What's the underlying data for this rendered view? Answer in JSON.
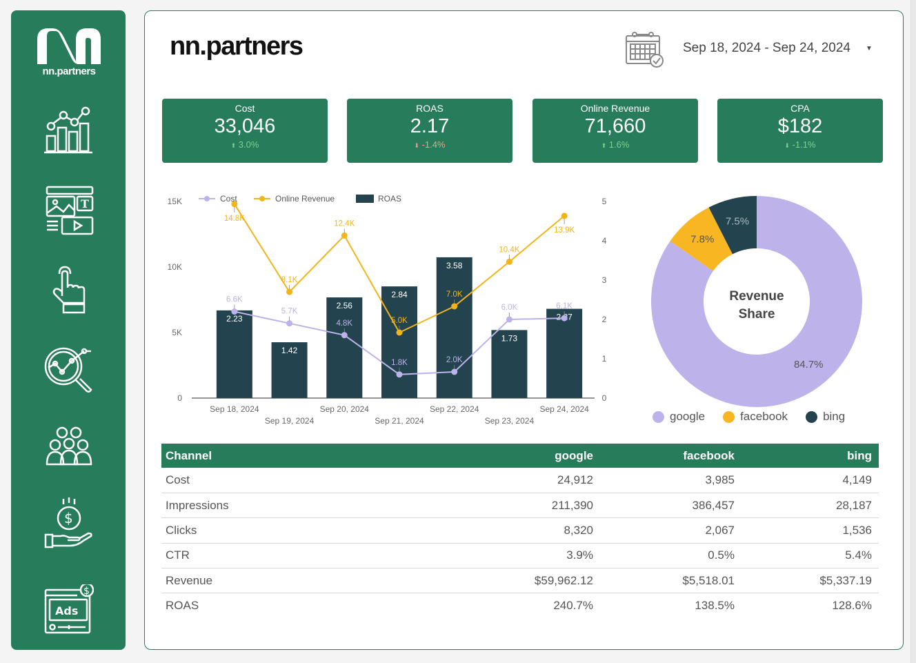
{
  "brand": {
    "name": "nn.partners",
    "sidebar_logo_text": "nn.partners"
  },
  "sidebar": {
    "items": [
      {
        "name": "analytics",
        "icon": "bar-line-chart-icon"
      },
      {
        "name": "content",
        "icon": "media-layout-icon"
      },
      {
        "name": "engagement",
        "icon": "pointing-hand-icon"
      },
      {
        "name": "insights",
        "icon": "magnifier-chart-icon"
      },
      {
        "name": "audience",
        "icon": "people-group-icon"
      },
      {
        "name": "revenue",
        "icon": "hand-coin-icon"
      },
      {
        "name": "ads",
        "icon": "ads-window-icon"
      }
    ]
  },
  "header": {
    "title": "nn.partners",
    "date_range": "Sep 18, 2024 - Sep 24, 2024",
    "date_icon": "calendar-check-icon",
    "dropdown_icon": "▾"
  },
  "kpis": [
    {
      "label": "Cost",
      "value": "33,046",
      "delta": "3.0%",
      "direction": "up",
      "arrow": "⬆"
    },
    {
      "label": "ROAS",
      "value": "2.17",
      "delta": "-1.4%",
      "direction": "down",
      "arrow": "⬇"
    },
    {
      "label": "Online Revenue",
      "value": "71,660",
      "delta": "1.6%",
      "direction": "up",
      "arrow": "⬆"
    },
    {
      "label": "CPA",
      "value": "$182",
      "delta": "-1.1%",
      "direction": "down",
      "arrow": "⬇"
    }
  ],
  "colors": {
    "brand_green": "#277c5b",
    "cost": "#bdb2ea",
    "revenue": "#f2b418",
    "roas_bar": "#23444f",
    "google": "#bdb2ea",
    "facebook": "#f8b722",
    "bing": "#23444f"
  },
  "chart_data": [
    {
      "type": "bar+line",
      "title": "",
      "categories": [
        "Sep 18, 2024",
        "Sep 19, 2024",
        "Sep 20, 2024",
        "Sep 21, 2024",
        "Sep 22, 2024",
        "Sep 23, 2024",
        "Sep 24, 2024"
      ],
      "legend": [
        "Cost",
        "Online Revenue",
        "ROAS"
      ],
      "legend_position": "top-left",
      "y_left": {
        "ticks": [
          "0",
          "5K",
          "10K",
          "15K"
        ],
        "range": [
          0,
          15000
        ]
      },
      "y_right": {
        "ticks": [
          "0",
          "1",
          "2",
          "3",
          "4",
          "5"
        ],
        "range": [
          0,
          5
        ]
      },
      "series": [
        {
          "name": "Cost",
          "type": "line",
          "axis": "left",
          "values": [
            6600,
            5700,
            4800,
            1800,
            2000,
            6000,
            6100
          ],
          "labels": [
            "6.6K",
            "5.7K",
            "4.8K",
            "1.8K",
            "2.0K",
            "6.0K",
            "6.1K"
          ]
        },
        {
          "name": "Online Revenue",
          "type": "line",
          "axis": "left",
          "values": [
            14800,
            8100,
            12400,
            5000,
            7000,
            10400,
            13900
          ],
          "labels": [
            "14.8K",
            "8.1K",
            "12.4K",
            "5.0K",
            "7.0K",
            "10.4K",
            "13.9K"
          ]
        },
        {
          "name": "ROAS",
          "type": "bar",
          "axis": "right",
          "values": [
            2.23,
            1.42,
            2.56,
            2.84,
            3.58,
            1.73,
            2.27
          ],
          "labels": [
            "2.23",
            "1.42",
            "2.56",
            "2.84",
            "3.58",
            "1.73",
            "2.27"
          ]
        }
      ]
    },
    {
      "type": "pie",
      "title": "Revenue Share",
      "center_label_line1": "Revenue",
      "center_label_line2": "Share",
      "slices": [
        {
          "name": "google",
          "value": 84.7,
          "label": "84.7%"
        },
        {
          "name": "facebook",
          "value": 7.8,
          "label": "7.8%"
        },
        {
          "name": "bing",
          "value": 7.5,
          "label": "7.5%"
        }
      ],
      "legend_position": "bottom"
    }
  ],
  "table": {
    "headers": [
      "Channel",
      "google",
      "facebook",
      "bing"
    ],
    "rows": [
      [
        "Cost",
        "24,912",
        "3,985",
        "4,149"
      ],
      [
        "Impressions",
        "211,390",
        "386,457",
        "28,187"
      ],
      [
        "Clicks",
        "8,320",
        "2,067",
        "1,536"
      ],
      [
        "CTR",
        "3.9%",
        "0.5%",
        "5.4%"
      ],
      [
        "Revenue",
        "$59,962.12",
        "$5,518.01",
        "$5,337.19"
      ],
      [
        "ROAS",
        "240.7%",
        "138.5%",
        "128.6%"
      ]
    ]
  }
}
